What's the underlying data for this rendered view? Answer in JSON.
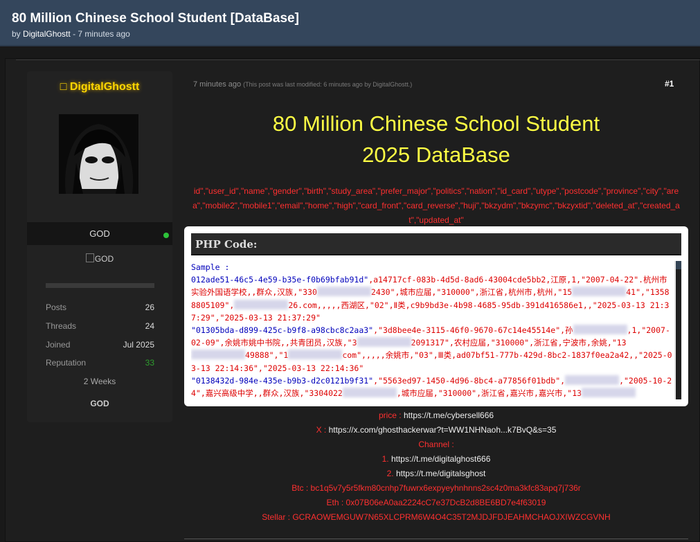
{
  "thread": {
    "title": "80 Million Chinese School Student [DataBase]",
    "by_prefix": "by",
    "author": "DigitalGhostt",
    "time": "- 7 minutes ago"
  },
  "user": {
    "name": "\u0000 DigitalGhostt",
    "rank": "GOD",
    "badge_alt": "GOD",
    "badge2_alt": "GOD",
    "stats": [
      {
        "k": "Posts",
        "v": "26"
      },
      {
        "k": "Threads",
        "v": "24"
      },
      {
        "k": "Joined",
        "v": "Jul 2025"
      },
      {
        "k": "Reputation",
        "v": "33"
      }
    ],
    "weeks": "2 Weeks"
  },
  "post": {
    "time": "7 minutes ago",
    "modified": "(This post was last modified: 6 minutes ago by DigitalGhostt.)",
    "number": "#1",
    "headline1": "80 Million Chinese School Student",
    "headline2": "2025 DataBase",
    "columns": "id\",\"user_id\",\"name\",\"gender\",\"birth\",\"study_area\",\"prefer_major\",\"politics\",\"nation\",\"id_card\",\"utype\",\"postcode\",\"province\",\"city\",\"area\",\"mobile2\",\"mobile1\",\"email\",\"home\",\"high\",\"card_front\",\"card_reverse\",\"huji\",\"bkzydm\",\"bkzymc\",\"bkzyxtid\",\"deleted_at\",\"created_at\",\"updated_at\"",
    "code_title": "PHP Code:",
    "code": {
      "l1": "Sample :",
      "r1a": "012ade51-46c5-4e59-b35e-f0b69bfab91d\"",
      "r1b": ",a14717cf-083b-4d5d-8ad6-43004cde5bb2,江原,1,\"2007-04-22\".杭州市实验外国语学校,,群众,汉族,\"330",
      "r1c": "2430\",城市应届,\"310000\",浙江省,杭州市,杭州,\"15",
      "r1d": "41\",\"13588805109\",",
      "r1e": "26.com,,,,,西湖区,\"02\",Ⅱ类,c9b9bd3e-4b98-4685-95db-391d416586e1,,\"2025-03-13 21:37:29\",\"2025-03-13 21:37:29\"",
      "r2a": "\"01305bda-d899-425c-b9f8-a98cbc8c2aa3\"",
      "r2b": ",\"3d8bee4e-3115-46f0-9670-67c14e45514e\",孙",
      "r2c": ",1,\"2007-02-09\",余姚市姚中书院,,共青团员,汉族,\"3",
      "r2d": "2091317\",农村应届,\"310000\",浙江省,宁波市,余姚,\"13",
      "r2e": "49888\",\"1",
      "r2f": "com\",,,,,余姚市,\"03\",Ⅲ类,ad07bf51-777b-429d-8bc2-1837f0ea2a42,,\"2025-03-13 22:14:36\",\"2025-03-13 22:14:36\"",
      "r3a": "\"0138432d-984e-435e-b9b3-d2c0121b9f31\"",
      "r3b": ",\"5563ed97-1450-4d96-8bc4-a77856f01bdb\",",
      "r3c": ",\"2005-10-24\",嘉兴高级中学,,群众,汉族,\"3304022",
      "r3d": ",城市应届,\"310000\",浙江省,嘉兴市,嘉兴市,\"13"
    },
    "links": {
      "price_label": "price :",
      "price_val": "https://t.me/cybersell666",
      "x_label": "X :",
      "x_val": "https://x.com/ghosthackerwar?t=WW1NHNaoh...k7BvQ&s=35",
      "channel_label": "Channel :",
      "ch1_num": "1.",
      "ch1_val": "https://t.me/digitalghost666",
      "ch2_num": "2.",
      "ch2_val": "https://t.me/digitalsghost",
      "btc": "Btc : bc1q5v7y5r5fkm80cnhp7fuwrx6expyeyhnhnns2sc4z0ma3kfc83apq7j736r",
      "eth": "Eth : 0x07B06eA0aa2224cC7e37DcB2d8BE6BD7e4f63019",
      "stellar": "Stellar : GCRAOWEMGUW7N65XLCPRM6W4O4C35T2MJDJFDJEAHMCHAOJXIWZCGVNH"
    }
  }
}
